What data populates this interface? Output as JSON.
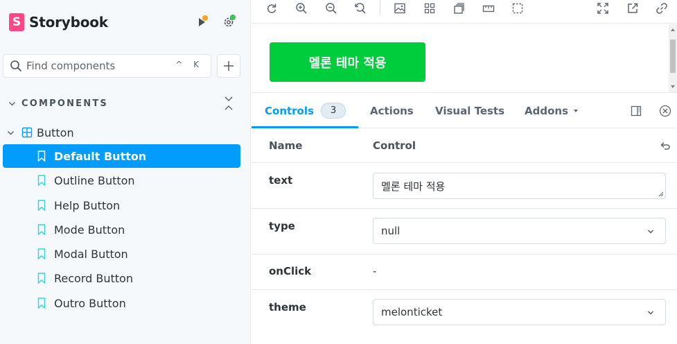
{
  "sidebar": {
    "brand": {
      "logo_letter": "S",
      "name": "Storybook",
      "logo_color": "#ff4785"
    },
    "icons": {
      "play": "play-icon",
      "settings": "gear-icon",
      "status_orange": "#f5a623",
      "status_green": "#34c759"
    },
    "search": {
      "placeholder": "Find components",
      "shortcut": "^ K"
    },
    "add_button_label": "+",
    "section_label": "COMPONENTS",
    "component": "Button",
    "stories": [
      {
        "label": "Default Button",
        "selected": true
      },
      {
        "label": "Outline Button"
      },
      {
        "label": "Help Button"
      },
      {
        "label": "Mode Button"
      },
      {
        "label": "Modal Button"
      },
      {
        "label": "Record Button"
      },
      {
        "label": "Outro Button"
      }
    ]
  },
  "toolbar": {
    "icons": [
      "refresh-icon",
      "zoom-in-icon",
      "zoom-out-icon",
      "zoom-reset-icon",
      "image-icon",
      "grid-icon",
      "background-icon",
      "measure-icon",
      "outline-icon",
      "fullscreen-icon",
      "open-new-icon",
      "link-icon"
    ]
  },
  "canvas": {
    "button_label": "멜론 테마 적용",
    "button_color": "#00cd3c"
  },
  "panel": {
    "tabs": [
      {
        "label": "Controls",
        "count": "3",
        "active": true
      },
      {
        "label": "Actions"
      },
      {
        "label": "Visual Tests"
      },
      {
        "label": "Addons"
      }
    ],
    "headers": {
      "name": "Name",
      "control": "Control"
    },
    "rows": [
      {
        "name": "text",
        "value": "멜론 테마 적용"
      },
      {
        "name": "type",
        "value": "null"
      },
      {
        "name": "onClick",
        "value": "-"
      },
      {
        "name": "theme",
        "value": "melonticket"
      }
    ]
  },
  "colors": {
    "accent": "#029cfd",
    "story_icon": "#37d5d3"
  }
}
